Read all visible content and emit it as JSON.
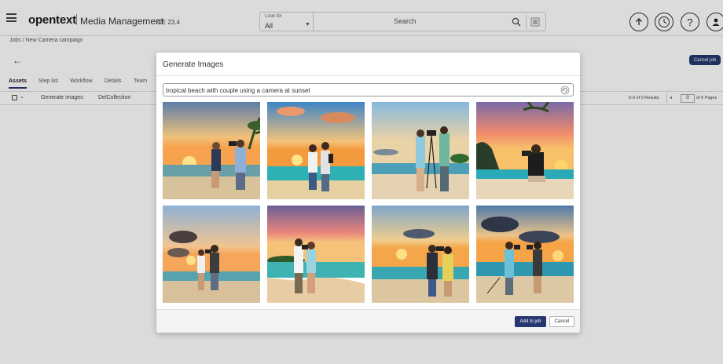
{
  "header": {
    "brand": "opentext",
    "app_name": "Media Management",
    "version": "CE 23.4",
    "look_for_label": "Look for",
    "look_for_value": "All",
    "search_placeholder": "Search"
  },
  "page": {
    "breadcrumb": "Jobs / New Camera campaign",
    "cancel_job_label": "Cancel job",
    "tabs": [
      "Assets",
      "Step list",
      "Workflow",
      "Details",
      "Team"
    ],
    "toolbar": {
      "generate_images": "Generate images",
      "del_collection": "DelCollection"
    },
    "results": "0-0 of 0 Results",
    "page_value": "0",
    "of_pages": "of 0 Pages"
  },
  "modal": {
    "title": "Generate Images",
    "prompt": "tropical beach with couple using a camera at sunset",
    "add_to_job_label": "Add to job",
    "cancel_label": "Cancel"
  },
  "colors": {
    "primary": "#25376e"
  }
}
